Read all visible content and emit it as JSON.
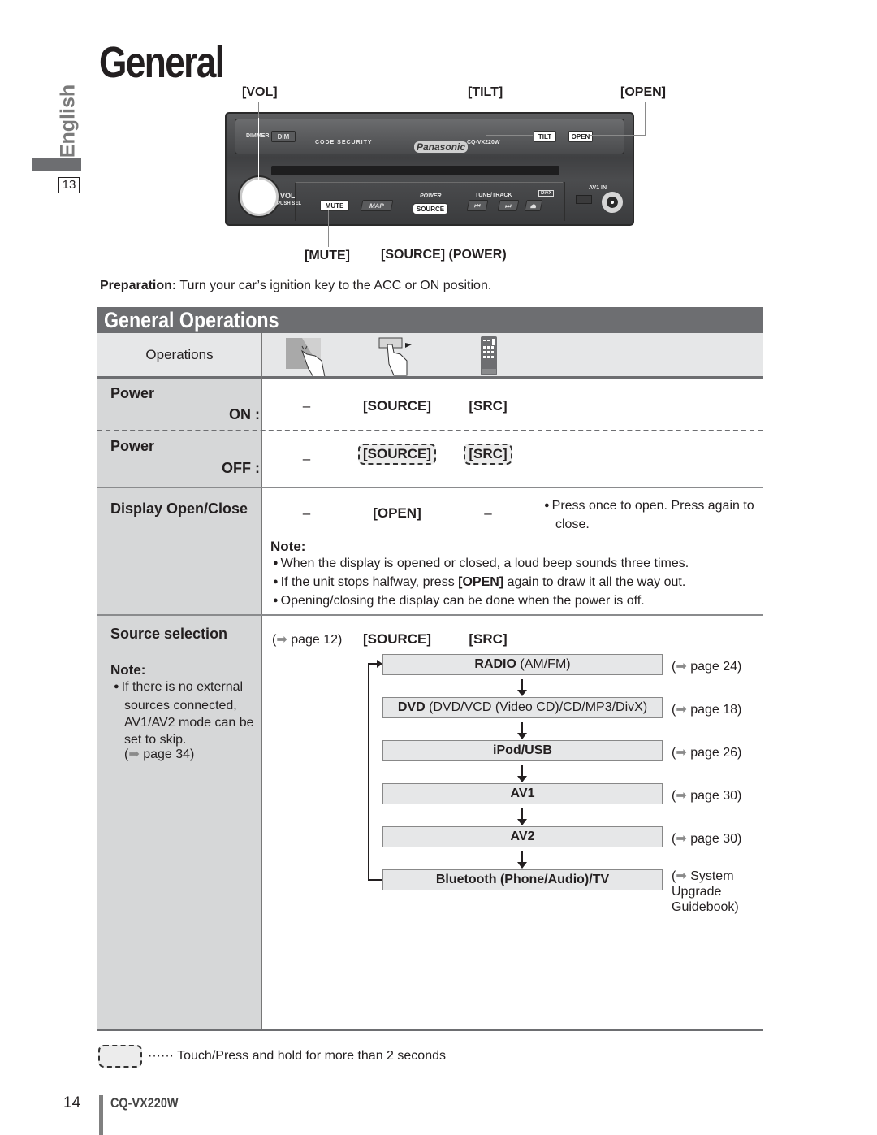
{
  "header": {
    "title": "General",
    "language_tab": "English",
    "section_page_box": "13"
  },
  "device": {
    "callouts": {
      "vol": "[VOL]",
      "tilt": "[TILT]",
      "open": "[OPEN]",
      "mute": "[MUTE]",
      "source_power": "[SOURCE] (POWER)"
    },
    "labels": {
      "dimmer": "DIMMER",
      "dim": "DIM",
      "code_security": "CODE SECURITY",
      "brand": "Panasonic",
      "model": "CQ-VX220W",
      "tilt": "TILT",
      "open": "OPEN",
      "vol": "VOL",
      "push_sel": "PUSH SEL",
      "mute": "MUTE",
      "map": "MAP",
      "power": "POWER",
      "source": "SOURCE",
      "tune_track": "TUNE/TRACK",
      "prev": "⏮",
      "next": "⏭",
      "eject": "⏏",
      "divx": "DivX",
      "av1_in": "AV1 IN"
    }
  },
  "preparation": {
    "label": "Preparation:",
    "text": " Turn your car’s ignition key to the ACC or ON position."
  },
  "section": {
    "title": "General Operations",
    "header_label": "Operations",
    "column_icons": [
      "touch-screen-icon",
      "press-button-icon",
      "remote-control-icon"
    ],
    "rows": {
      "power_on": {
        "label": "Power",
        "sub": "ON :",
        "touch": "–",
        "button": "[SOURCE]",
        "remote": "[SRC]"
      },
      "power_off": {
        "label": "Power",
        "sub": "OFF :",
        "touch": "–",
        "button": "[SOURCE]",
        "remote": "[SRC]"
      },
      "display": {
        "label": "Display Open/Close",
        "touch": "–",
        "button": "[OPEN]",
        "remote": "–",
        "description": "Press once to open. Press again to close.",
        "note_title": "Note:",
        "notes": [
          "When the display is opened or closed, a loud beep sounds three times.",
          "If the unit stops halfway, press ",
          "Opening/closing the display can be done when the power is off."
        ],
        "note2_bold": "[OPEN]",
        "note2_rest": " again to draw it all the way out."
      },
      "source": {
        "label": "Source selection",
        "touch": "page 12",
        "button": "[SOURCE]",
        "remote": "[SRC]",
        "note_title": "Note:",
        "note_text": "If there is no external sources connected, AV1/AV2 mode can be set to skip.",
        "note_ref": "page 34",
        "flow": [
          {
            "bold": "RADIO",
            "rest": " (AM/FM)",
            "ref": "page 24"
          },
          {
            "bold": "DVD",
            "rest": " (DVD/VCD (Video CD)/CD/MP3/DivX)",
            "ref": "page 18"
          },
          {
            "bold": "iPod/USB",
            "rest": "",
            "ref": "page 26"
          },
          {
            "bold": "AV1",
            "rest": "",
            "ref": "page 30"
          },
          {
            "bold": "AV2",
            "rest": "",
            "ref": "page 30"
          },
          {
            "bold": "Bluetooth (Phone/Audio)/TV",
            "rest": "",
            "ref": "System Upgrade Guidebook"
          }
        ]
      }
    }
  },
  "legend": {
    "dots": "······",
    "text": "Touch/Press and hold for more than 2 seconds"
  },
  "footer": {
    "page_number": "14",
    "model": "CQ-VX220W"
  }
}
